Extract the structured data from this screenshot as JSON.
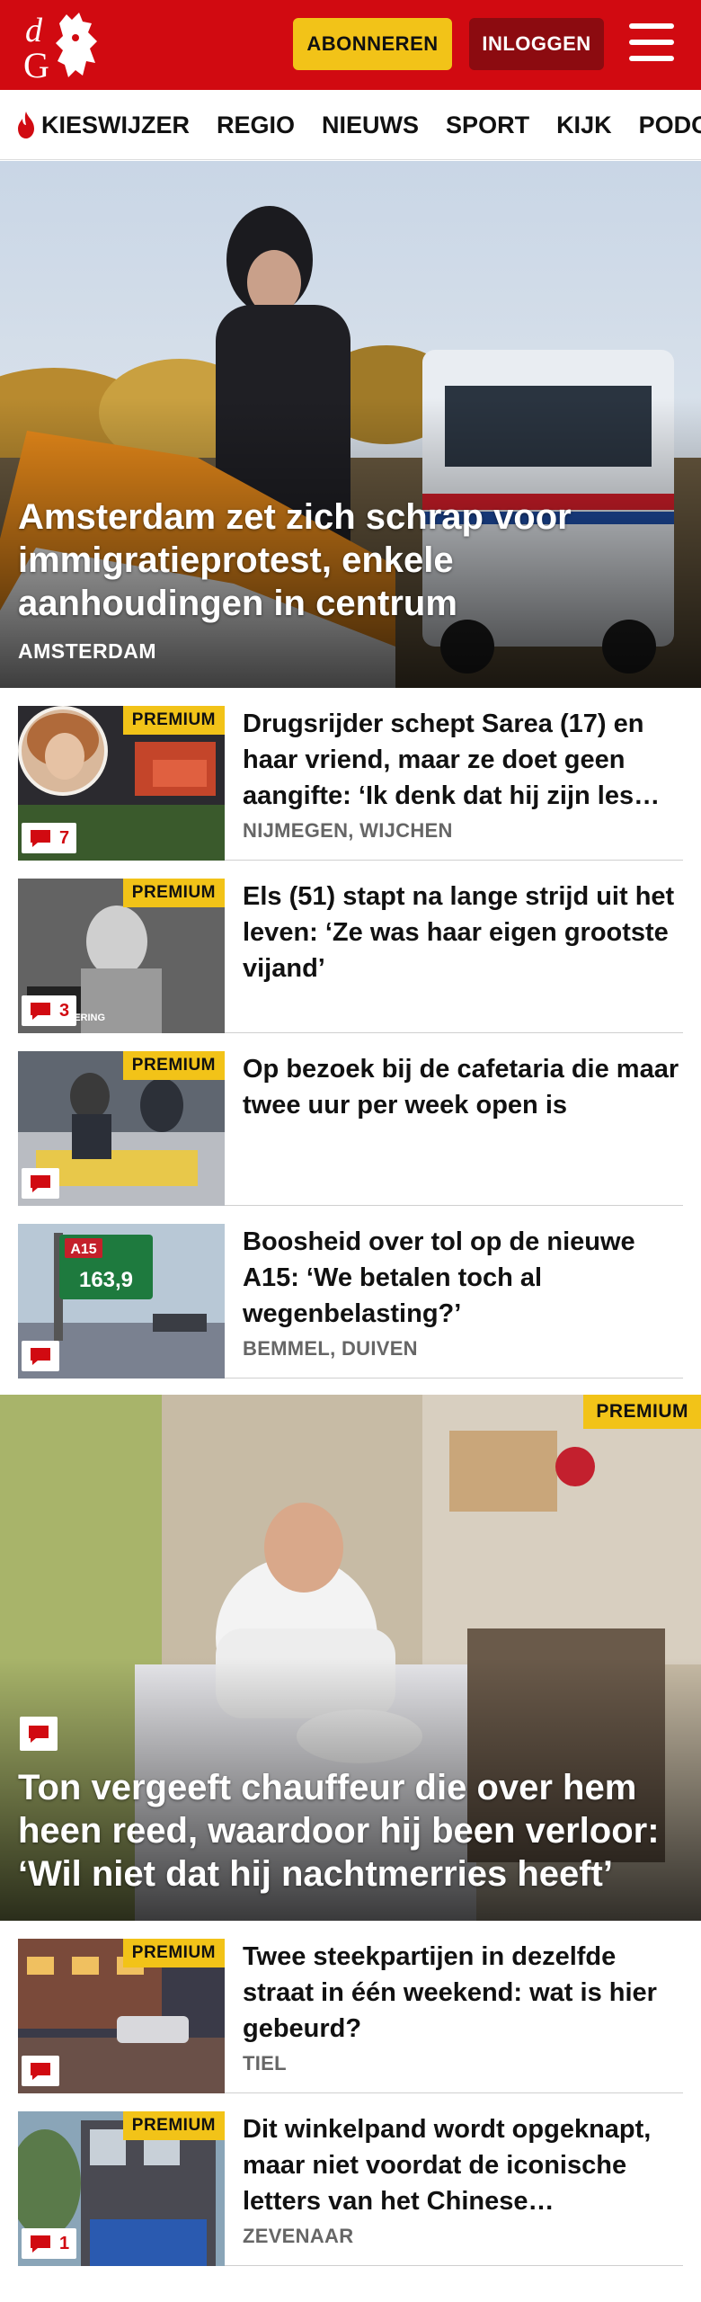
{
  "header": {
    "logo_text": "dG",
    "subscribe_label": "ABONNEREN",
    "login_label": "INLOGGEN",
    "brand_color": "#d10a11"
  },
  "nav": {
    "items": [
      {
        "label": "KIESWIJZER",
        "icon": "flame-icon"
      },
      {
        "label": "REGIO"
      },
      {
        "label": "NIEUWS"
      },
      {
        "label": "SPORT"
      },
      {
        "label": "KIJK"
      },
      {
        "label": "PODCASTS"
      }
    ]
  },
  "hero": {
    "title": "Amsterdam zet zich schrap voor immigratieprotest, enkele aanhoudingen in centrum",
    "location": "AMSTERDAM"
  },
  "articles": [
    {
      "premium": "PREMIUM",
      "title": "Drugsrijder schept Sarea (17) en haar vriend, maar ze doet geen aangifte: ‘Ik denk dat hij zijn les…",
      "location": "NIJMEGEN, WIJCHEN",
      "comments": "7"
    },
    {
      "premium": "PREMIUM",
      "title": "Els (51) stapt na lange strijd uit het leven: ‘Ze was haar eigen grootste vijand’",
      "location": "",
      "comments": "3",
      "thumb_caption": "IN HERINNERING"
    },
    {
      "premium": "PREMIUM",
      "title": "Op bezoek bij de cafetaria die maar twee uur per week open is",
      "location": "",
      "comments": ""
    },
    {
      "premium": "",
      "title": "Boosheid over tol op de nieuwe A15: ‘We betalen toch al wegenbelasting?’",
      "location": "BEMMEL, DUIVEN",
      "comments": "",
      "sign_road": "A15",
      "sign_km": "163,9"
    }
  ],
  "feature": {
    "premium": "PREMIUM",
    "title": "Ton vergeeft chauffeur die over hem heen reed, waardoor hij been verloor: ‘Wil niet dat hij nachtmerries heeft’"
  },
  "articles2": [
    {
      "premium": "PREMIUM",
      "title": "Twee steekpartijen in dezelfde straat in één weekend: wat is hier gebeurd?",
      "location": "TIEL",
      "comments": ""
    },
    {
      "premium": "PREMIUM",
      "title": "Dit winkelpand wordt opgeknapt, maar niet voordat de iconische letters van het Chinese…",
      "location": "ZEVENAAR",
      "comments": "1"
    }
  ],
  "colors": {
    "premium": "#f2c318",
    "login_button": "#8c0b10",
    "comment_red": "#d10a11"
  }
}
